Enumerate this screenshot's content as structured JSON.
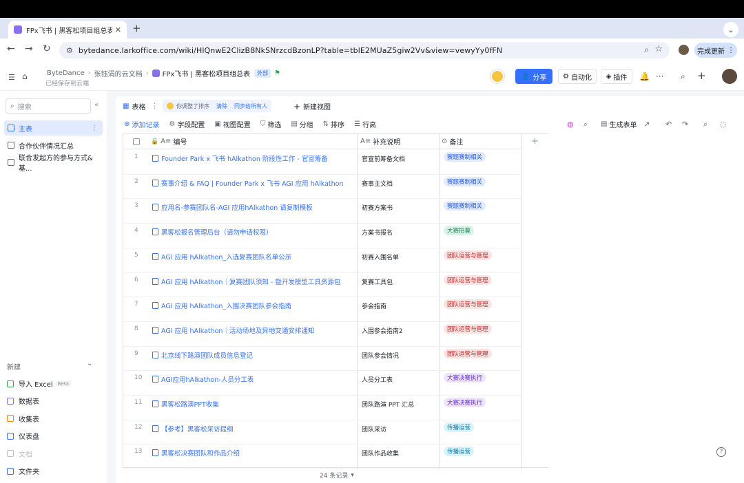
{
  "browser": {
    "tab_title": "FPx飞书 | 黑客松项目组总表 ·",
    "url": "bytedance.larkoffice.com/wiki/HlQnwE2ClizB8NkSNrzcdBzonLP?table=tblE2MUaZ5giw2Vv&view=vewyYy0fFN",
    "update_label": "完成更新"
  },
  "header": {
    "crumbs": [
      "ByteDance",
      "张钰涓的云文档",
      "FPx飞书 | 黑客松项目组总表"
    ],
    "badge": "外部",
    "saved": "已经保存到云端",
    "share_label": "分享",
    "automation_label": "自动化",
    "plugin_label": "插件"
  },
  "sidebar": {
    "search_placeholder": "搜索",
    "items": [
      {
        "label": "主表",
        "active": true
      },
      {
        "label": "合作伙伴情况汇总",
        "active": false
      },
      {
        "label": "联合发起方的参与方式&基...",
        "active": false
      }
    ],
    "new_label": "新建",
    "new_items": [
      {
        "label": "导入 Excel",
        "beta": "Beta",
        "color": "#34a853"
      },
      {
        "label": "数据表",
        "color": "#8b6df0"
      },
      {
        "label": "收集表",
        "color": "#ff8800"
      },
      {
        "label": "仪表盘",
        "color": "#3370ff"
      },
      {
        "label": "文档",
        "color": "#bbbfc4",
        "disabled": true
      },
      {
        "label": "文件夹",
        "color": "#3370ff"
      }
    ]
  },
  "view": {
    "tab_label": "表格",
    "notice": "你调整了排序",
    "notice_clear": "清除",
    "notice_sync": "同步给所有人",
    "new_view": "新建视图"
  },
  "toolbar": {
    "add_record": "添加记录",
    "field_config": "字段配置",
    "view_config": "视图配置",
    "filter": "筛选",
    "group": "分组",
    "sort": "排序",
    "row_height": "行高",
    "gen_form": "生成表单"
  },
  "table": {
    "columns": [
      "编号",
      "补充说明",
      "备注"
    ],
    "rows": [
      {
        "n": "1",
        "title": "Founder Park x 飞书 hAlkathon 阶段性工作 - 官宣筹备",
        "note": "官宣前筹备文档",
        "tag": "赛题赛制相关",
        "tag_bg": "#e1eaff",
        "tag_fg": "#245bdb"
      },
      {
        "n": "2",
        "title": "赛事介绍 & FAQ | Founder Park x 飞书 AGI 应用 hAlkathon",
        "note": "赛事主文档",
        "tag": "赛题赛制相关",
        "tag_bg": "#e1eaff",
        "tag_fg": "#245bdb"
      },
      {
        "n": "3",
        "title": "应用名-参赛团队名-AGI 应用hAlkathon 请复制模板",
        "note": "初赛方案书",
        "tag": "赛题赛制相关",
        "tag_bg": "#e1eaff",
        "tag_fg": "#245bdb"
      },
      {
        "n": "4",
        "title": "黑客松报名管理后台（请勿申请权限）",
        "note": "方案书报名",
        "tag": "大赛招募",
        "tag_bg": "#d9f5e9",
        "tag_fg": "#1a7f4f"
      },
      {
        "n": "5",
        "title": "AGI 应用 hAlkathon_入选复赛团队名单公示",
        "note": "初赛入围名单",
        "tag": "团队运营与管理",
        "tag_bg": "#fde2e2",
        "tag_fg": "#c02d2d"
      },
      {
        "n": "6",
        "title": "AGI 应用 hAlkathon｜复赛团队须知 - 暨开发模型工具资源包",
        "note": "复赛工具包",
        "tag": "团队运营与管理",
        "tag_bg": "#fde2e2",
        "tag_fg": "#c02d2d"
      },
      {
        "n": "7",
        "title": "AGI 应用 hAlkathon_入围决赛团队参会指南",
        "note": "参会指南",
        "tag": "团队运营与管理",
        "tag_bg": "#fde2e2",
        "tag_fg": "#c02d2d"
      },
      {
        "n": "8",
        "title": "AGI 应用 hAlkathon｜活动场地及异地交通安排通知",
        "note": "入围参会指南2",
        "tag": "团队运营与管理",
        "tag_bg": "#fde2e2",
        "tag_fg": "#c02d2d"
      },
      {
        "n": "9",
        "title": "北京线下路演团队成员信息登记",
        "note": "团队参会情况",
        "tag": "团队运营与管理",
        "tag_bg": "#fde2e2",
        "tag_fg": "#c02d2d"
      },
      {
        "n": "10",
        "title": "AGI应用hAlkathon-人员分工表",
        "note": "人员分工表",
        "tag": "大赛决赛执行",
        "tag_bg": "#ece4fd",
        "tag_fg": "#6425d0"
      },
      {
        "n": "11",
        "title": "黑客松路演PPT收集",
        "note": "团队路演 PPT 汇总",
        "tag": "大赛决赛执行",
        "tag_bg": "#ece4fd",
        "tag_fg": "#6425d0"
      },
      {
        "n": "12",
        "title": "【参考】黑客松采访提纲",
        "note": "团队采访",
        "tag": "传播运营",
        "tag_bg": "#d9f3fd",
        "tag_fg": "#0f7ba8"
      },
      {
        "n": "13",
        "title": "黑客松决赛团队和作品介绍",
        "note": "团队作品收集",
        "tag": "传播运营",
        "tag_bg": "#d9f3fd",
        "tag_fg": "#0f7ba8"
      }
    ],
    "count_label": "24 条记录"
  }
}
